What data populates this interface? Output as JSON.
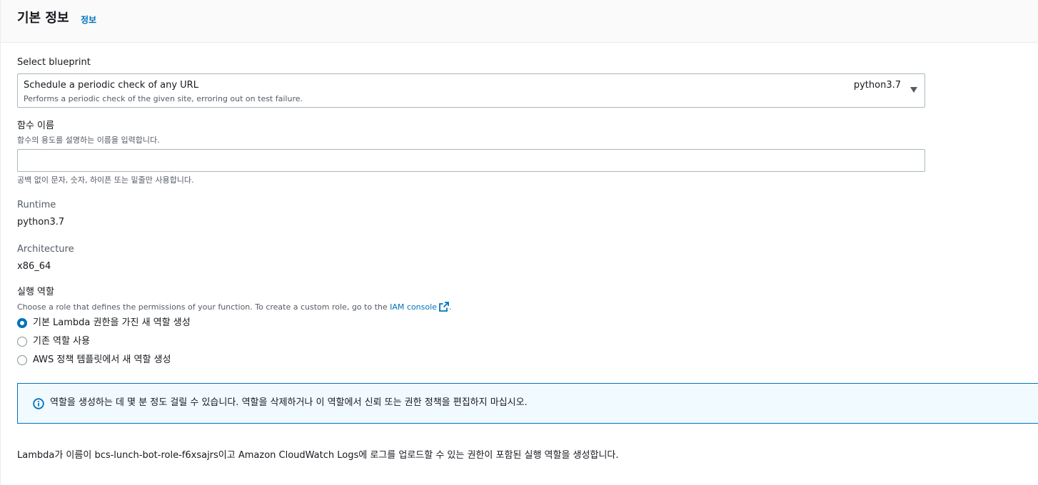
{
  "header": {
    "title": "기본 정보",
    "info_link": "정보"
  },
  "blueprint": {
    "label": "Select blueprint",
    "selected_title": "Schedule a periodic check of any URL",
    "selected_description": "Performs a periodic check of the given site, erroring out on test failure.",
    "selected_runtime": "python3.7"
  },
  "function_name": {
    "label": "함수 이름",
    "description": "함수의 용도를 설명하는 이름을 입력합니다.",
    "value": "",
    "placeholder": "",
    "constraint": "공백 없이 문자, 숫자, 하이픈 또는 밑줄만 사용합니다."
  },
  "runtime": {
    "label": "Runtime",
    "value": "python3.7"
  },
  "architecture": {
    "label": "Architecture",
    "value": "x86_64"
  },
  "execution_role": {
    "label": "실행 역할",
    "description_prefix": "Choose a role that defines the permissions of your function. To create a custom role, go to the ",
    "description_link": "IAM console",
    "description_suffix": ".",
    "options": [
      {
        "label": "기본 Lambda 권한을 가진 새 역할 생성",
        "selected": true
      },
      {
        "label": "기존 역할 사용",
        "selected": false
      },
      {
        "label": "AWS 정책 템플릿에서 새 역할 생성",
        "selected": false
      }
    ]
  },
  "alert": {
    "icon": "info-icon",
    "text": "역할을 생성하는 데 몇 분 정도 걸릴 수 있습니다. 역할을 삭제하거나 이 역할에서 신뢰 또는 권한 정책을 편집하지 마십시오."
  },
  "footer": {
    "text": "Lambda가 이름이 bcs-lunch-bot-role-f6xsajrs이고 Amazon CloudWatch Logs에 로그를 업로드할 수 있는 권한이 포함된 실행 역할을 생성합니다."
  },
  "colors": {
    "accent": "#0073bb",
    "alert_background": "#f1faff",
    "header_background": "#fafafa"
  }
}
